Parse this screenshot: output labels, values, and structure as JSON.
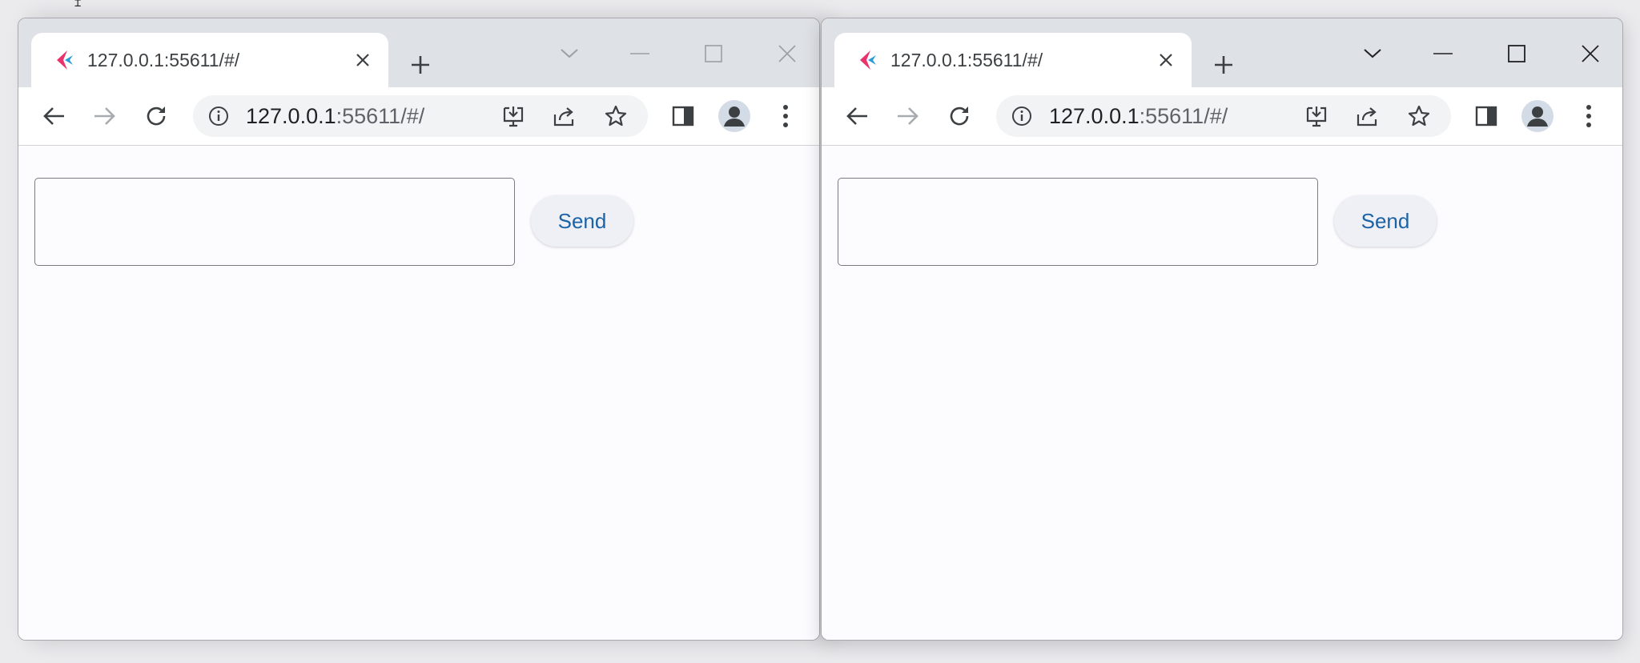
{
  "desktop": {
    "cursor_glyph": "⌶"
  },
  "windows": [
    {
      "tab": {
        "title": "127.0.0.1:55611/#/"
      },
      "omnibox": {
        "host": "127.0.0.1",
        "rest": ":55611/#/"
      },
      "page": {
        "input_value": "",
        "send_label": "Send"
      }
    },
    {
      "tab": {
        "title": "127.0.0.1:55611/#/"
      },
      "omnibox": {
        "host": "127.0.0.1",
        "rest": ":55611/#/"
      },
      "page": {
        "input_value": "",
        "send_label": "Send"
      }
    }
  ],
  "colors": {
    "tabstrip": "#dee1e6",
    "omnibox": "#f1f3f4",
    "send_text": "#1c63a6",
    "favicon_pink": "#e8336d",
    "favicon_blue": "#2a9bd8"
  },
  "icons": {
    "favicon": "flutter-like-favicon",
    "tab_close": "close-icon",
    "new_tab": "plus-icon",
    "tab_search": "chevron-down-icon",
    "minimize": "minimize-icon",
    "maximize": "maximize-icon",
    "close": "close-icon",
    "back": "arrow-left-icon",
    "forward": "arrow-right-icon",
    "reload": "reload-icon",
    "site_info": "info-icon",
    "install": "install-icon",
    "share": "share-icon",
    "bookmark": "star-icon",
    "side_panel": "side-panel-icon",
    "profile": "profile-icon",
    "menu": "kebab-menu-icon"
  }
}
